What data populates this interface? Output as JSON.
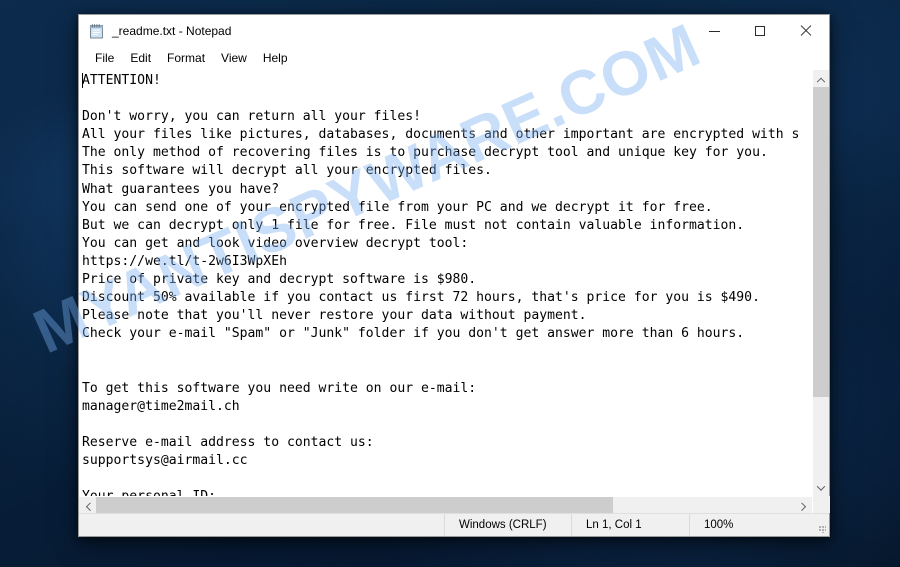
{
  "desktop": {
    "watermark": "MYANTISPYWARE.COM",
    "background_color": "#0a2340"
  },
  "window": {
    "title": "_readme.txt - Notepad",
    "icon": "notepad-icon",
    "controls": {
      "minimize": "Minimize",
      "maximize": "Maximize",
      "close": "Close"
    }
  },
  "menu": {
    "items": [
      {
        "label": "File"
      },
      {
        "label": "Edit"
      },
      {
        "label": "Format"
      },
      {
        "label": "View"
      },
      {
        "label": "Help"
      }
    ]
  },
  "editor": {
    "content": "ATTENTION!\n\nDon't worry, you can return all your files!\nAll your files like pictures, databases, documents and other important are encrypted with s\nThe only method of recovering files is to purchase decrypt tool and unique key for you.\nThis software will decrypt all your encrypted files.\nWhat guarantees you have?\nYou can send one of your encrypted file from your PC and we decrypt it for free.\nBut we can decrypt only 1 file for free. File must not contain valuable information.\nYou can get and look video overview decrypt tool:\nhttps://we.tl/t-2w6I3WpXEh\nPrice of private key and decrypt software is $980.\nDiscount 50% available if you contact us first 72 hours, that's price for you is $490.\nPlease note that you'll never restore your data without payment.\nCheck your e-mail \"Spam\" or \"Junk\" folder if you don't get answer more than 6 hours.\n\n\nTo get this software you need write on our e-mail:\nmanager@time2mail.ch\n\nReserve e-mail address to contact us:\nsupportsys@airmail.cc\n\nYour personal ID:",
    "lines": [
      "ATTENTION!",
      "",
      "Don't worry, you can return all your files!",
      "All your files like pictures, databases, documents and other important are encrypted with s",
      "The only method of recovering files is to purchase decrypt tool and unique key for you.",
      "This software will decrypt all your encrypted files.",
      "What guarantees you have?",
      "You can send one of your encrypted file from your PC and we decrypt it for free.",
      "But we can decrypt only 1 file for free. File must not contain valuable information.",
      "You can get and look video overview decrypt tool:",
      "https://we.tl/t-2w6I3WpXEh",
      "Price of private key and decrypt software is $980.",
      "Discount 50% available if you contact us first 72 hours, that's price for you is $490.",
      "Please note that you'll never restore your data without payment.",
      "Check your e-mail \"Spam\" or \"Junk\" folder if you don't get answer more than 6 hours.",
      "",
      "",
      "To get this software you need write on our e-mail:",
      "manager@time2mail.ch",
      "",
      "Reserve e-mail address to contact us:",
      "supportsys@airmail.cc",
      "",
      "Your personal ID:"
    ],
    "details": {
      "ransom_price_full": "$980",
      "ransom_price_discount": "$490",
      "discount_percent": "50%",
      "discount_window_hours": "72 hours",
      "response_window_hours": "6 hours",
      "video_url": "https://we.tl/t-2w6I3WpXEh",
      "primary_email": "manager@time2mail.ch",
      "reserve_email": "supportsys@airmail.cc"
    }
  },
  "statusbar": {
    "encoding": "Windows (CRLF)",
    "position": "Ln 1, Col 1",
    "zoom": "100%"
  },
  "scrollbars": {
    "vertical_up": "scroll-up",
    "vertical_down": "scroll-down",
    "horizontal_left": "scroll-left",
    "horizontal_right": "scroll-right"
  }
}
